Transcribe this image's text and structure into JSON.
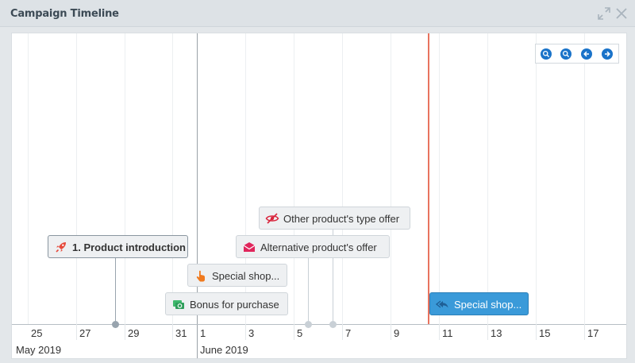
{
  "panel": {
    "title": "Campaign Timeline"
  },
  "header_icons": [
    "expand-icon",
    "close-icon"
  ],
  "zoom_controls": [
    {
      "name": "zoom-in-button",
      "icon": "zoom-in-icon"
    },
    {
      "name": "zoom-out-button",
      "icon": "zoom-out-icon"
    },
    {
      "name": "scroll-left-button",
      "icon": "arrow-left-icon"
    },
    {
      "name": "scroll-right-button",
      "icon": "arrow-right-icon"
    }
  ],
  "axis": {
    "ticks": [
      "25",
      "27",
      "29",
      "31",
      "1",
      "3",
      "5",
      "7",
      "9",
      "11",
      "13",
      "15",
      "17"
    ],
    "months": [
      "May 2019",
      "June 2019"
    ]
  },
  "items": [
    {
      "label": "1. Product introduction",
      "icon": "rocket-icon",
      "style": "bold",
      "color": "#e64a3c"
    },
    {
      "label": "Other product's type offer",
      "icon": "eye-slash-icon",
      "color": "#d9263e"
    },
    {
      "label": "Alternative product's offer",
      "icon": "envelope-icon",
      "color": "#e0265c"
    },
    {
      "label": "Special shop...",
      "icon": "hand-pointer-icon",
      "color": "#f07a1e"
    },
    {
      "label": "Bonus for purchase",
      "icon": "money-icon",
      "color": "#3eb86c"
    },
    {
      "label": "Special shop...",
      "icon": "reply-all-icon",
      "style": "highlighted",
      "color": "#3a9ad9"
    }
  ],
  "colors": {
    "accent": "#1a73c9",
    "now_line": "#e8735f",
    "highlight": "#3a9ad9"
  }
}
